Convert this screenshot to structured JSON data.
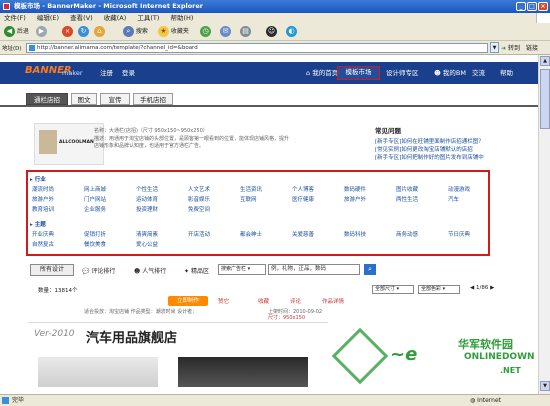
{
  "window": {
    "title": "模板市场 - BannerMaker - Microsoft Internet Explorer"
  },
  "menu": [
    "文件(F)",
    "编辑(E)",
    "查看(V)",
    "收藏(A)",
    "工具(T)",
    "帮助(H)"
  ],
  "toolbar": {
    "back": "后退",
    "search": "搜索",
    "favorites": "收藏夹"
  },
  "address": {
    "label": "地址(D)",
    "url": "http://banner.alimama.com/template/?channel_id=&board",
    "go": "转到",
    "links": "链接"
  },
  "site": {
    "logo_main": "BANNER",
    "logo_sub": "maker",
    "nav_left": [
      "注册",
      "登录"
    ],
    "nav": [
      "我的首页",
      "模板市场",
      "设计师专区",
      "我的BM",
      "交流",
      "帮助"
    ]
  },
  "tabs": [
    "通栏店招",
    "图文",
    "宣传",
    "手机店招"
  ],
  "banner": {
    "thumb_text": "ALLCOOLMAN",
    "info1": "名称：大通栏(店招)（尺寸 950x150~950x250）",
    "info2": "描述：用通用于淘宝店铺的头部位置，是顾客第一眼看到的位置，能体现店铺风格，提升",
    "info3": "店铺形象和品牌认知度，也适用于官方通栏广告。"
  },
  "common_issues": {
    "title": "常见问题",
    "items": [
      "[新手专区]如何在旺铺里面制作店招通栏图？",
      "[常见实例]如何更改淘宝店铺默认的店招",
      "[新手专区]如何把制作好的图片发布到店铺中"
    ]
  },
  "filter": {
    "industry_label": "行业",
    "industry_rows": [
      [
        "潮流时尚",
        "网上商城",
        "个性生活",
        "人文艺术",
        "生活资讯",
        "个人博客",
        "数码硬件",
        "图片收藏",
        "动漫游戏"
      ],
      [
        "旅游户外",
        "门户网站",
        "运动体育",
        "影音娱乐",
        "互联网",
        "医疗健康",
        "旅游户外",
        "两性生活",
        "汽车"
      ],
      [
        "教育培训",
        "企业服务",
        "投资理财",
        "免费空间"
      ]
    ],
    "theme_label": "主题",
    "theme_rows": [
      [
        "开业庆典",
        "促销打折",
        "清爽简素",
        "开店活动",
        "都会绅士",
        "关爱慈善",
        "数码科技",
        "商务动感",
        "节日庆典"
      ],
      [
        "自然复古",
        "餐饮美食",
        "爱心公益"
      ]
    ]
  },
  "actions": {
    "all_designs": "所有设计",
    "sort1": "评论排行",
    "sort2": "人气排行",
    "sort3": "精品区",
    "search_scope": "搜索广告栏",
    "search_placeholder": "例，礼物，正品，数码"
  },
  "list": {
    "count": "数量：13814个",
    "size_select": "全部尺寸",
    "color_select": "全部色彩",
    "page": "1/86"
  },
  "footer_strip": {
    "buttons": [
      "立即制作",
      "赞它",
      "收藏",
      "评论",
      "作品详情"
    ],
    "meta": "适合投放：淘宝店铺   作品类型：潮流时尚   设计者：",
    "size": "尺寸：950x150",
    "date": "上架时间：2010-09-02"
  },
  "ad_preview": {
    "year": "Ver-2010",
    "title": "汽车用品旗舰店"
  },
  "watermark": {
    "line1": "华军软件园",
    "line2": "ONLINEDOWN",
    "line3": ".NET"
  },
  "status": {
    "text": "完毕",
    "zone": "Internet"
  }
}
